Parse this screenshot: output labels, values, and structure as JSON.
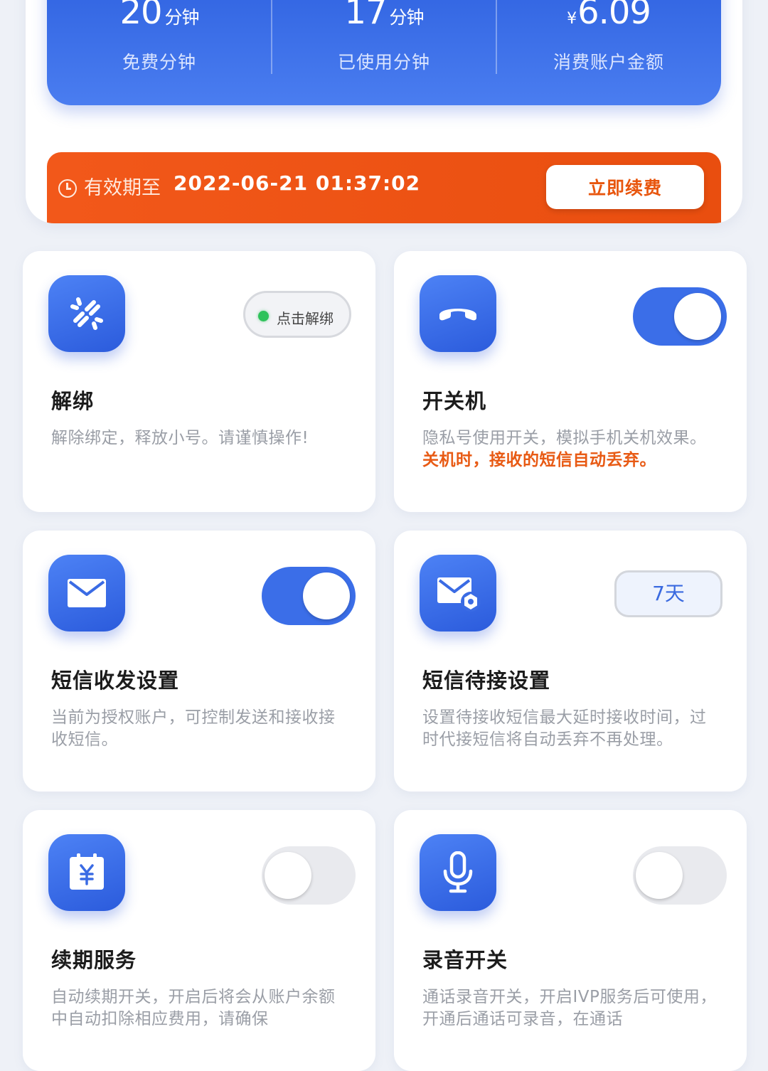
{
  "stats": [
    {
      "value": "20",
      "unit": "分钟",
      "label": "免费分钟"
    },
    {
      "value": "17",
      "unit": "分钟",
      "label": "已使用分钟"
    },
    {
      "currency": "¥",
      "value": "6.09",
      "label": "消费账户金额"
    }
  ],
  "expiry": {
    "label": "有效期至",
    "date": "2022-06-21 01:37:02",
    "renew_label": "立即续费"
  },
  "features": {
    "unbind": {
      "title": "解绑",
      "desc": "解除绑定，释放小号。请谨慎操作!",
      "pill": "点击解绑"
    },
    "power": {
      "title": "开关机",
      "desc": "隐私号使用开关，模拟手机关机效果。",
      "warn": "关机时，接收的短信自动丢弃。",
      "toggle_on": true
    },
    "sms": {
      "title": "短信收发设置",
      "desc": "当前为授权账户，可控制发送和接收接收短信。",
      "toggle_on": true
    },
    "sms_pending": {
      "title": "短信待接设置",
      "desc": "设置待接收短信最大延时接收时间，过时代接短信将自动丢弃不再处理。",
      "pill": "7天"
    },
    "renewal": {
      "title": "续期服务",
      "desc": "自动续期开关，开启后将会从账户余额中自动扣除相应费用，请确保",
      "toggle_on": false
    },
    "recording": {
      "title": "录音开关",
      "desc": "通话录音开关，开启IVP服务后可使用，开通后通话可录音，在通话",
      "toggle_on": false
    }
  }
}
